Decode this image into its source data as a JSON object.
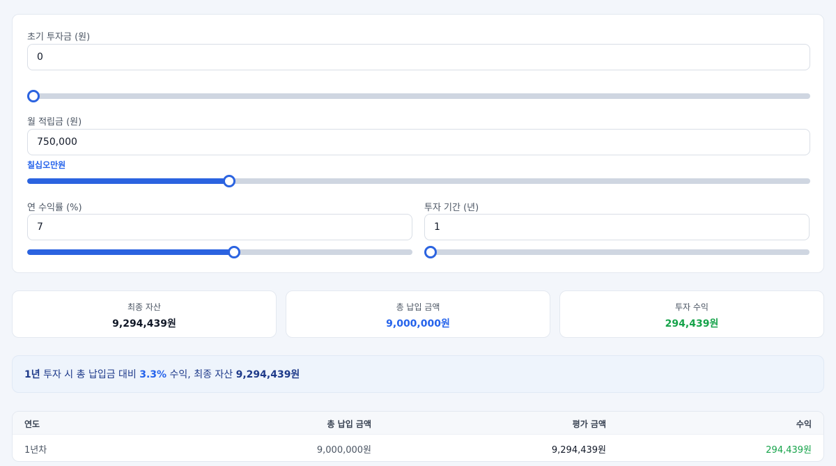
{
  "inputs": {
    "initial": {
      "label": "초기 투자금 (원)",
      "value": "0",
      "slider_fraction": 0.0
    },
    "monthly": {
      "label": "월 적립금 (원)",
      "value": "750,000",
      "hint": "칠십오만원",
      "slider_fraction": 0.254
    },
    "rate": {
      "label": "연 수익률 (%)",
      "value": "7",
      "slider_fraction": 0.538
    },
    "period": {
      "label": "투자 기간 (년)",
      "value": "1",
      "slider_fraction": 0.0
    }
  },
  "stats": [
    {
      "label": "최종 자산",
      "value": "9,294,439원",
      "color": "#111827"
    },
    {
      "label": "총 납입 금액",
      "value": "9,000,000원",
      "color": "#2563eb"
    },
    {
      "label": "투자 수익",
      "value": "294,439원",
      "color": "#16a34a"
    }
  ],
  "summary": {
    "years": "1년",
    "text_1": " 투자 시 총 납입금 대비 ",
    "percent": "3.3%",
    "text_2": " 수익, 최종 자산 ",
    "final": "9,294,439원"
  },
  "table": {
    "headers": [
      "연도",
      "총 납입 금액",
      "평가 금액",
      "수익"
    ],
    "rows": [
      {
        "year": "1년차",
        "contributed": "9,000,000원",
        "value": "9,294,439원",
        "profit": "294,439원"
      }
    ]
  },
  "colors": {
    "accent": "#2b63e0",
    "profit": "#16a34a",
    "bg": "#f3f6fb"
  }
}
